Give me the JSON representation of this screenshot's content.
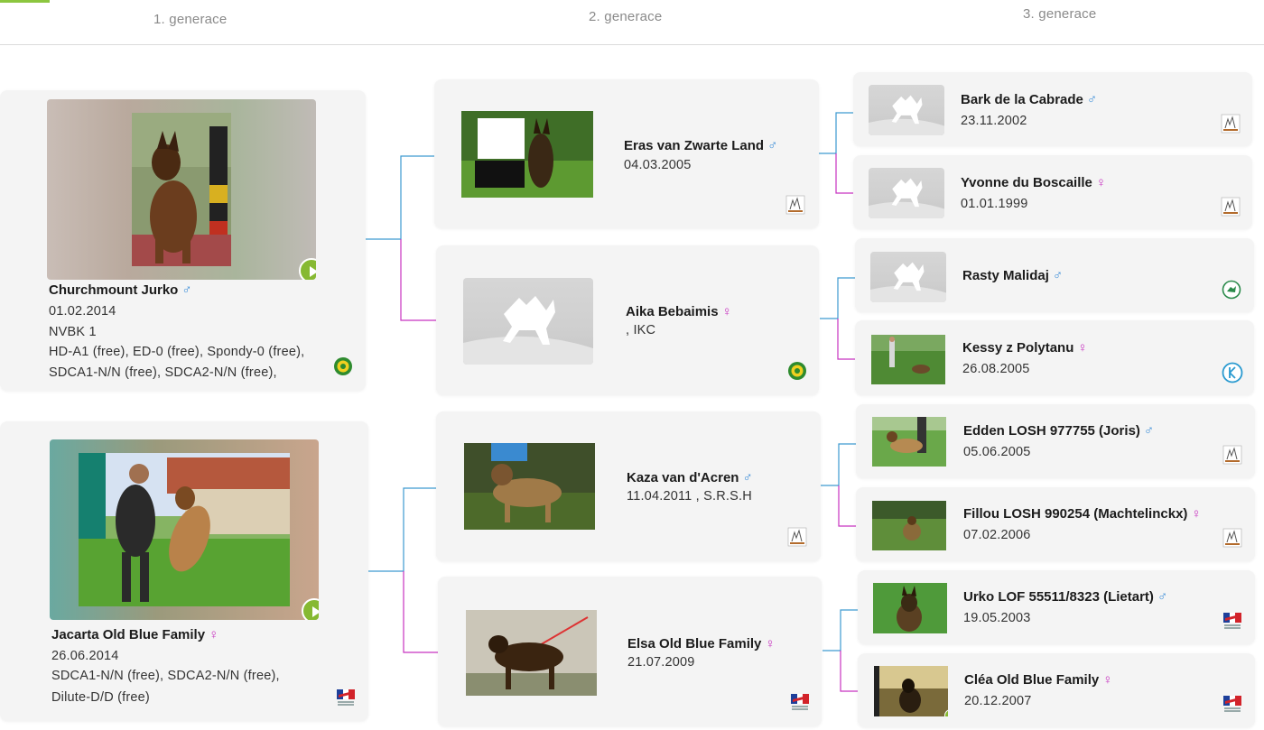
{
  "tabs": [
    {
      "label": "1. generace"
    },
    {
      "label": "2. generace"
    },
    {
      "label": "3. generace"
    }
  ],
  "colors": {
    "accent": "#8cc63f",
    "male": "#3d8ed8",
    "female": "#c733c0"
  },
  "gen1": {
    "sire": {
      "name": "Churchmount Jurko",
      "sex_symbol": "♂",
      "date": "01.02.2014",
      "lines": [
        "NVBK 1",
        "HD-A1 (free), ED-0 (free), Spondy-0 (free),",
        "SDCA1-N/N (free), SDCA2-N/N (free),"
      ],
      "badge": "nvbk-logo-icon",
      "photo_caption": "Churchmount Jurko"
    },
    "dam": {
      "name": "Jacarta Old Blue Family",
      "sex_symbol": "♀",
      "date": "26.06.2014",
      "lines": [
        "SDCA1-N/N (free), SDCA2-N/N (free),",
        "Dilute-D/D (free)"
      ],
      "badge": "central-canine-logo-icon"
    }
  },
  "gen2": [
    {
      "name": "Eras van Zwarte Land",
      "sex_symbol": "♂",
      "detail": "04.03.2005",
      "badge": "sr-sh-logo-icon"
    },
    {
      "name": "Aika Bebaimis",
      "sex_symbol": "♀",
      "detail": ", IKC",
      "badge": "nvbk-logo-icon"
    },
    {
      "name": "Kaza van d'Acren",
      "sex_symbol": "♂",
      "detail": "11.04.2011 , S.R.S.H",
      "badge": "sr-sh-logo-icon"
    },
    {
      "name": "Elsa Old Blue Family",
      "sex_symbol": "♀",
      "detail": "21.07.2009",
      "badge": "central-canine-logo-icon"
    }
  ],
  "gen3": [
    {
      "name": "Bark de la Cabrade",
      "sex_symbol": "♂",
      "detail": "23.11.2002",
      "badge": "sr-sh-logo-icon"
    },
    {
      "name": "Yvonne du Boscaille",
      "sex_symbol": "♀",
      "detail": "01.01.1999",
      "badge": "sr-sh-logo-icon"
    },
    {
      "name": "Rasty Malidaj",
      "sex_symbol": "♂",
      "detail": "",
      "badge": "green-round-logo-icon"
    },
    {
      "name": "Kessy z Polytanu",
      "sex_symbol": "♀",
      "detail": "26.08.2005",
      "badge": "k-logo-icon"
    },
    {
      "name": "Edden LOSH 977755 (Joris)",
      "sex_symbol": "♂",
      "detail": "05.06.2005",
      "badge": "sr-sh-logo-icon"
    },
    {
      "name": "Fillou LOSH 990254 (Machtelinckx)",
      "sex_symbol": "♀",
      "detail": "07.02.2006",
      "badge": "sr-sh-logo-icon"
    },
    {
      "name": "Urko LOF 55511/8323 (Lietart)",
      "sex_symbol": "♂",
      "detail": "19.05.2003",
      "badge": "central-canine-logo-icon"
    },
    {
      "name": "Cléa Old Blue Family",
      "sex_symbol": "♀",
      "detail": "20.12.2007",
      "badge": "central-canine-logo-icon"
    }
  ]
}
